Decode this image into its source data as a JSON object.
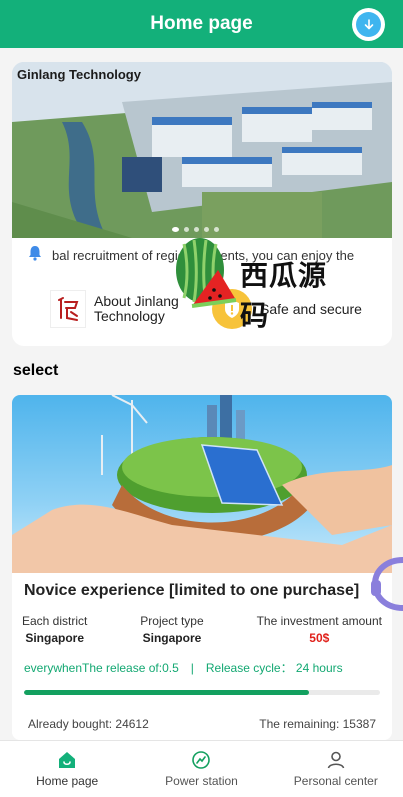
{
  "header": {
    "title": "Home page",
    "download_icon": "download-arrow-icon"
  },
  "banner": {
    "label": "Ginlang Technology",
    "dots": 5,
    "active_dot": 0
  },
  "notice": {
    "icon": "bell-icon",
    "text": "bal recruitment of regional agents, you can enjoy the"
  },
  "features": [
    {
      "label": "About Jinlang Technology",
      "icon": "jinlang-logo"
    },
    {
      "label": "Safe and secure",
      "icon": "shield-icon"
    }
  ],
  "section": {
    "title": "select"
  },
  "product": {
    "title": "Novice experience [limited to one purchase]",
    "stats": [
      {
        "label": "Each district",
        "value": "Singapore"
      },
      {
        "label": "Project type",
        "value": "Singapore"
      },
      {
        "label": "The investment amount",
        "value": "50$"
      }
    ],
    "release_text": "everywhenThe release of:0.5　|　Release cycle： 24 hours",
    "progress": 0.8,
    "footer_left": "Already bought: 24612",
    "footer_right": "The remaining: 15387"
  },
  "watermark": {
    "text": "西瓜源码"
  },
  "tabs": [
    {
      "label": "Home page",
      "icon": "home-icon",
      "active": true
    },
    {
      "label": "Power station",
      "icon": "gauge-icon",
      "active": false
    },
    {
      "label": "Personal center",
      "icon": "user-icon",
      "active": false
    }
  ],
  "colors": {
    "primary": "#13b07a",
    "accent_red": "#e0201a",
    "progress": "#13a05f"
  }
}
